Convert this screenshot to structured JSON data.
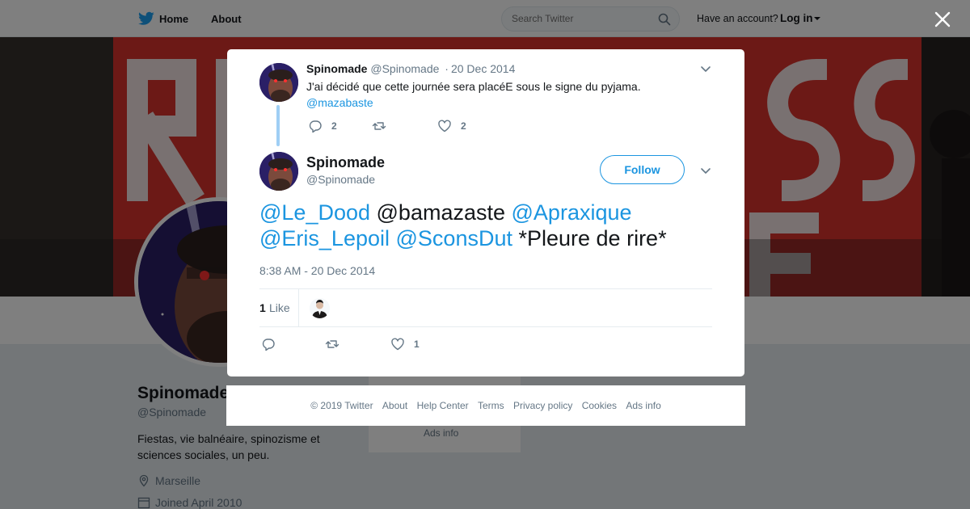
{
  "nav": {
    "home_label": "Home",
    "about_label": "About",
    "search_placeholder": "Search Twitter",
    "account_prompt": "Have an account?",
    "login_label": "Log in"
  },
  "profile": {
    "name": "Spinomade",
    "handle": "@Spinomade",
    "bio": "Fiestas, vie balnéaire, spinozisme et sciences sociales, un peu.",
    "location": "Marseille",
    "joined": "Joined April 2010",
    "side_ads_info": "Ads info"
  },
  "reply_tweet": {
    "name": "Spinomade",
    "handle": "@Spinomade",
    "separator": "·",
    "date": "20 Dec 2014",
    "text": "J'ai décidé que cette journée sera placéE sous le signe du pyjama.",
    "mention": "@mazabaste",
    "reply_count": "2",
    "retweet_count": "",
    "like_count": "2"
  },
  "main_tweet": {
    "name": "Spinomade",
    "handle": "@Spinomade",
    "follow_label": "Follow",
    "text_parts": {
      "m1": "@Le_Dood",
      "t1": " @bamazaste ",
      "m2": "@Apraxique",
      "m3": "@Eris_Lepoil",
      "t2": " ",
      "m4": "@SconsDut",
      "t3": " *Pleure de rire*"
    },
    "timestamp": "8:38 AM - 20 Dec 2014",
    "likes_count": "1",
    "likes_label": "Like",
    "reply_count": "",
    "retweet_count": "",
    "like_count": "1"
  },
  "footer": {
    "links": [
      "© 2019 Twitter",
      "About",
      "Help Center",
      "Terms",
      "Privacy policy",
      "Cookies",
      "Ads info"
    ]
  },
  "colors": {
    "accent": "#1b95e0",
    "thread_line": "#9fcff5",
    "muted_text": "#657786",
    "banner_red": "#d8322d"
  },
  "icons": [
    "twitter-bird-icon",
    "search-icon",
    "close-icon",
    "reply-icon",
    "retweet-icon",
    "heart-icon",
    "chevron-down-icon",
    "location-icon",
    "calendar-icon"
  ]
}
